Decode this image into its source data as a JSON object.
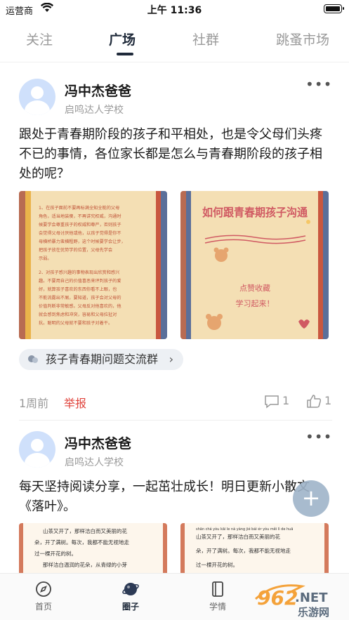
{
  "status": {
    "carrier": "运营商",
    "time": "上午 11:36"
  },
  "tabs": [
    {
      "label": "关注"
    },
    {
      "label": "广场"
    },
    {
      "label": "社群"
    },
    {
      "label": "跳蚤市场"
    }
  ],
  "posts": [
    {
      "author": "冯中杰爸爸",
      "school": "启鸣达人学校",
      "content": "跟处于青春期阶段的孩子和平相处，也是令父母们头疼不已的事情，各位家长都是怎么与青春期阶段的孩子相处的呢？",
      "images": [
        {
          "lines": [
            "1、在孩子面前不要再标满全知全能的父母",
            "角色，适当地装傻，不再讲究权威，沟通时",
            "候要学会尊重孩子的权威和尊严，否则孩子",
            "会觉得父母讨厌他或他，以孩子觉得是你不",
            "母横桥暴力蛮横粗野，这个时候要学会让步，",
            "把孩子放在优势学的位置，父母先学会",
            "示弱。",
            "2、对孩子感兴趣的事物表现出欣赏和感兴",
            "趣。不要用自己的价值喜恶来评判孩子的爱",
            "好，就算孩子喜欢的东西你看不上眼，也",
            "不能流露出不屑，要知道，孩子会对父母的",
            "价值判断非常敏感。父母反对他喜欢的，他",
            "就会感到焦虑和冲突，容易和父母拉扯对",
            "抗。聪明的父母就不要和孩子对着干。"
          ]
        },
        {
          "title": "如何跟青春期孩子沟通",
          "footer1": "点赞收藏",
          "footer2": "学习起来！"
        }
      ],
      "group": "孩子青春期问题交流群",
      "time_ago": "1周前",
      "report": "举报",
      "comments": "1",
      "likes": "1"
    },
    {
      "author": "冯中杰爸爸",
      "school": "启鸣达人学校",
      "content": "每天坚持阅读分享，一起茁壮成长！明日更新小散文《落叶》。",
      "images": [
        {
          "line1": "山茶又开了，那样洁白而又美丽的花",
          "line2": "朵，开了满树。每次，我都不能无视地走",
          "line3": "过一棵开花的树。",
          "line4": "那样洁白温润的花朵，从青绿的小芽"
        },
        {
          "pinyin": "shān chá yòu kāi le   nà yàng jié bái ér yòu měi lì de huā",
          "line1": "山茶又开了，那样洁白而又美丽的花",
          "line2": "朵，开了满树。每次，我都不能无视地走",
          "line3": "过一棵开花的树。"
        }
      ]
    }
  ],
  "bottom_nav": [
    {
      "label": "首页"
    },
    {
      "label": "圈子"
    },
    {
      "label": "学情"
    }
  ],
  "watermark": {
    "text_main": "962",
    "text_net": ".NET",
    "text_sub": "乐游网"
  }
}
